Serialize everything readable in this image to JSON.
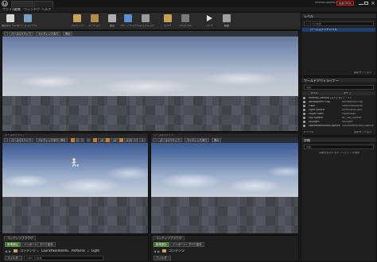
{
  "window": {
    "tabs": [
      "",
      ""
    ],
    "search_help": "検索(Help)",
    "project_name": "Minimal Default (Untitled)"
  },
  "menu": {
    "items": [
      "ファイル",
      "編集",
      "ウィンドウ",
      "ヘルプ"
    ]
  },
  "toolbar": {
    "buttons": [
      {
        "label": "現在のレベルを保存",
        "icon": "save-icon",
        "color": "#d8d8d8"
      },
      {
        "label": "ソースコントロール",
        "icon": "source-control-icon",
        "color": "#7aa0c8"
      },
      {
        "label": "",
        "icon": "",
        "color": ""
      },
      {
        "label": "コンテンツ",
        "icon": "content-icon",
        "color": "#c9a35a"
      },
      {
        "label": "マーケット",
        "icon": "marketplace-icon",
        "color": "#b58b4a"
      },
      {
        "label": "設定",
        "icon": "settings-icon",
        "color": "#b0b0b0"
      },
      {
        "label": "ブループリント",
        "icon": "blueprint-icon",
        "color": "#5a8fd0"
      },
      {
        "label": "シネマティック",
        "icon": "cinematic-icon",
        "color": "#9c9c9c"
      },
      {
        "label": "ビルド",
        "icon": "build-icon",
        "color": "#c8a050"
      },
      {
        "label": "コンパイル",
        "icon": "compile-icon",
        "color": "#7a7a7a"
      },
      {
        "label": "プレイ",
        "icon": "play-icon",
        "color": "#e0e0e0"
      },
      {
        "label": "起動",
        "icon": "launch-icon",
        "color": "#a0a0a0"
      }
    ]
  },
  "viewports": {
    "top": {
      "perspective": "パースペクティブ",
      "lit": "ライティングあり",
      "show": "表示"
    },
    "top_right_label": "",
    "bottom_left": {
      "label": "パースペクティブ",
      "perspective": "パースペクティブ",
      "lit": "ライティングあり",
      "show": "表示",
      "snap1": "10",
      "snap2": "10°",
      "snap3": "0.25",
      "cam": "4"
    },
    "bottom_right": {
      "label": "パースペクティブ",
      "perspective": "パースペクティブ",
      "lit": "ライティングあり",
      "show": "表示"
    }
  },
  "modes": {
    "title": "モード"
  },
  "levels": {
    "title": "レベル",
    "search_placeholder": "レベルの検索",
    "persistent_level": "パーシステントレベル",
    "view_options": "表示オプション"
  },
  "outliner": {
    "title": "ワールドアウトライナー",
    "search_placeholder": "検索",
    "col_label": "ラベル",
    "col_type": "タイプ",
    "rows": [
      {
        "label": "Minimal_Default (エディタ)",
        "type": "ワールド"
      },
      {
        "label": "Atmospheric Fog",
        "type": "AtmosphericFog"
      },
      {
        "label": "Floor",
        "type": "StaticMeshActor"
      },
      {
        "label": "Light Source",
        "type": "DirectionalLight"
      },
      {
        "label": "Player Start",
        "type": "PlayerStart"
      },
      {
        "label": "Sky Sphere",
        "type": "BP_Sky_Sphere"
      },
      {
        "label": "SkyLight",
        "type": "SkyLight"
      },
      {
        "label": "SphereReflectionCapture",
        "type": "SphereReflectionCapture"
      }
    ],
    "count": "8 アクタ",
    "view_options": "表示オプション"
  },
  "details": {
    "title": "詳細",
    "empty": "詳細を表示するオブジェクトを選択",
    "search_placeholder": "検索"
  },
  "content_browser": {
    "tab1": "コンテンツブラウザ",
    "tab2": "コンテンツブラウザ",
    "add_new": "新規追加",
    "import": "インポート",
    "save_all": "すべて保存",
    "path": [
      "コンテンツ",
      "LaunchElements",
      "Particles",
      "Light"
    ],
    "filter": "フィルタ",
    "search_placeholder": "Light を検索",
    "path_right": [
      "コンテンツ"
    ]
  }
}
